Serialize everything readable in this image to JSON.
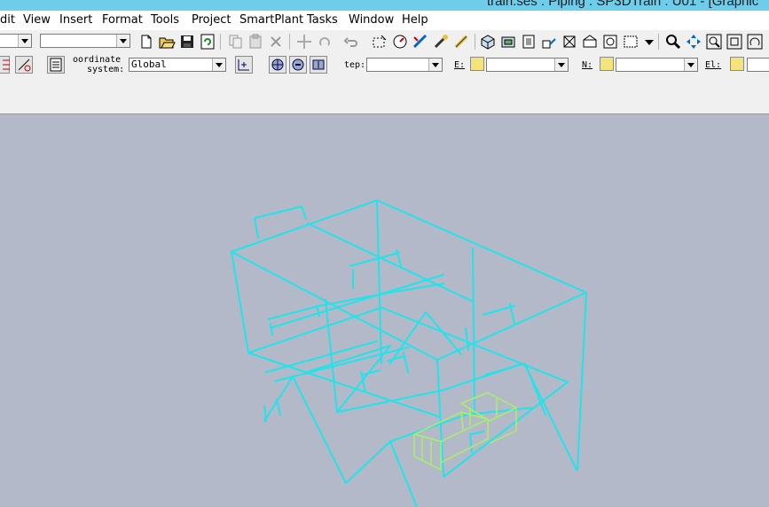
{
  "window": {
    "title": "train.ses : Piping : SP3DTrain : U01 - [Graphic"
  },
  "menu": [
    "dit",
    "View",
    "Insert",
    "Format",
    "Tools",
    "Project",
    "SmartPlant",
    "Tasks",
    "Window",
    "Help"
  ],
  "toolbar": {
    "combo1_value": "",
    "combo2_value": "",
    "coord_label_line1": "oordinate",
    "coord_label_line2": "system:",
    "coord_system_value": "Global",
    "step_label": "tep:",
    "step_value": "",
    "e_label": "E:",
    "e_value": "",
    "n_label": "N:",
    "n_value": "",
    "el_label": "El:",
    "el_value": ""
  },
  "colors": {
    "wireframe": "#22e3ea",
    "highlight": "#a8f06a",
    "background": "#b3b9c9",
    "titlebar": "#6dcdea"
  }
}
